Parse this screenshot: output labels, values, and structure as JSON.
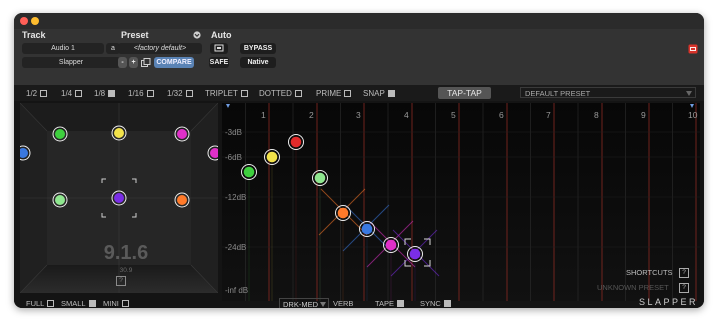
{
  "window": {
    "traffic_colors": [
      "#ff5f57",
      "#febc2e"
    ]
  },
  "header": {
    "track_label": "Track",
    "track_name": "Audio 1",
    "track_variant": "a",
    "track_insert": "Slapper",
    "preset_label": "Preset",
    "preset_name": "<factory default>",
    "compare_label": "COMPARE",
    "safe_label": "SAFE",
    "auto_label": "Auto",
    "bypass_label": "BYPASS",
    "native_label": "Native",
    "minus": "-",
    "plus": "+"
  },
  "options": {
    "half": "1/2",
    "quarter": "1/4",
    "eighth": "1/8",
    "sixteenth": "1/16",
    "thirtysecond": "1/32",
    "triplet": "TRIPLET",
    "dotted": "DOTTED",
    "prime": "PRIME",
    "snap": "SNAP",
    "taptap": "TAP-TAP",
    "preset_select": "DEFAULT PRESET"
  },
  "room": {
    "version": "9.1.6",
    "sub_version": "30.9",
    "help": "?"
  },
  "delay": {
    "beats": [
      "1",
      "2",
      "3",
      "4",
      "5",
      "6",
      "7",
      "8",
      "9",
      "10"
    ],
    "db_labels": [
      "-3dB",
      "-6dB",
      "-12dB",
      "-24dB",
      "-inf dB"
    ],
    "taps": [
      {
        "color": "#3ecf3e"
      },
      {
        "color": "#f2e24a"
      },
      {
        "color": "#e02a2a"
      },
      {
        "color": "#8fe68f"
      },
      {
        "color": "#ff7a2a"
      },
      {
        "color": "#3a78e0"
      },
      {
        "color": "#e030c8"
      },
      {
        "color": "#7a2ee6"
      }
    ],
    "shortcuts": "SHORTCUTS",
    "unknown_preset": "UNKNOWN PRESET",
    "help": "?"
  },
  "footer": {
    "full": "FULL",
    "small": "SMALL",
    "mini": "MINI",
    "drk_med": "DRK-MED",
    "verb": "VERB",
    "tape": "TAPE",
    "sync": "SYNC",
    "brand": "SLAPPER"
  }
}
